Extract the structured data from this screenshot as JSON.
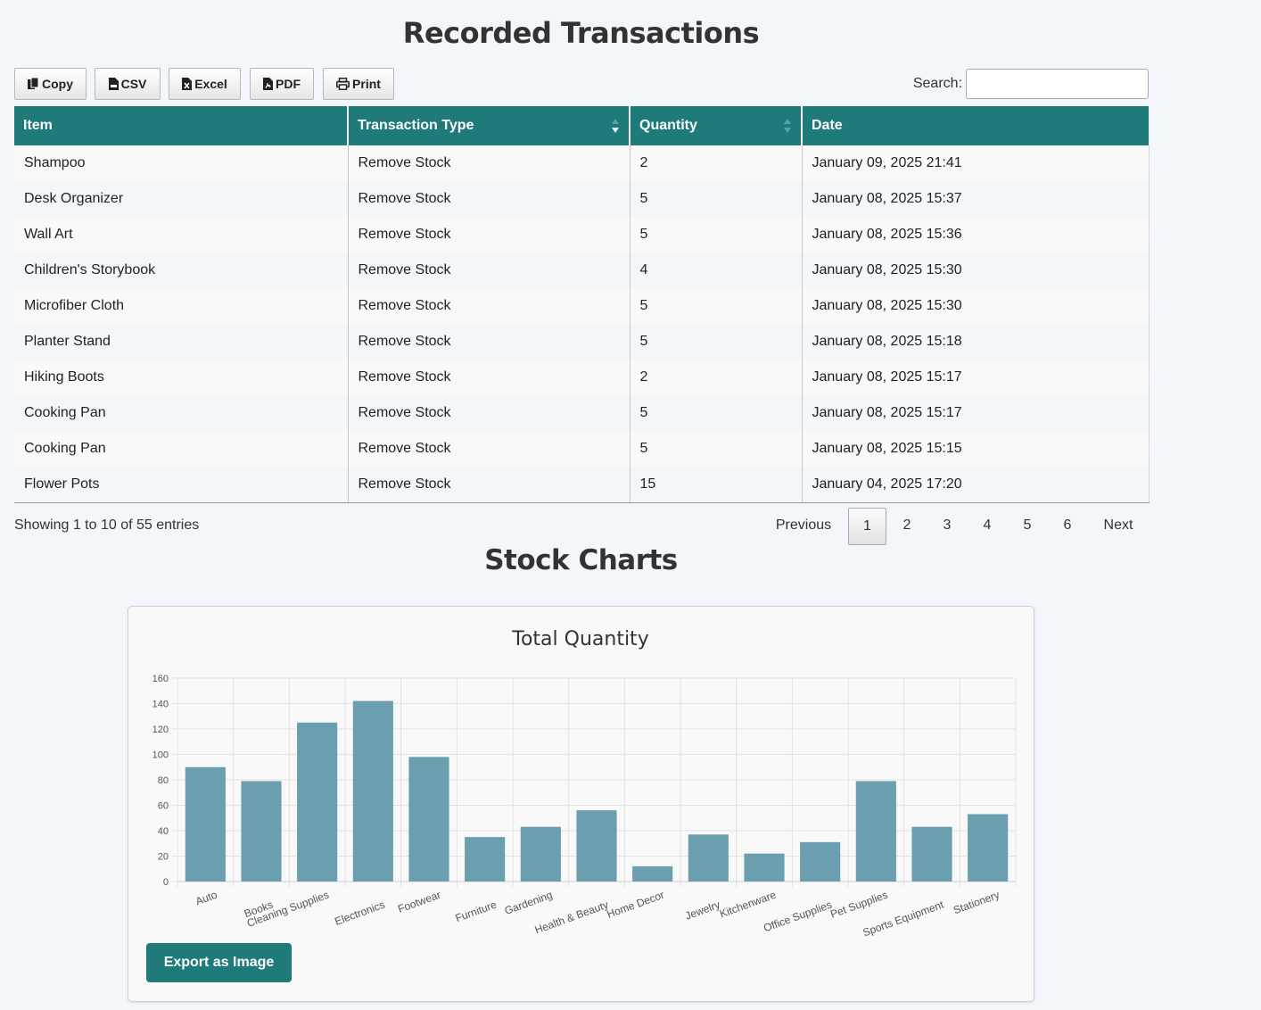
{
  "page_title": "Recorded Transactions",
  "toolbar": {
    "buttons": [
      {
        "label": "Copy",
        "icon": "copy-icon"
      },
      {
        "label": "CSV",
        "icon": "csv-file-icon"
      },
      {
        "label": "Excel",
        "icon": "excel-file-icon"
      },
      {
        "label": "PDF",
        "icon": "pdf-file-icon"
      },
      {
        "label": "Print",
        "icon": "print-icon"
      }
    ],
    "search_label": "Search:",
    "search_value": ""
  },
  "table": {
    "headers": [
      "Item",
      "Transaction Type",
      "Quantity",
      "Date"
    ],
    "header_color": "#1f7a7a",
    "rows": [
      [
        "Shampoo",
        "Remove Stock",
        "2",
        "January 09, 2025 21:41"
      ],
      [
        "Desk Organizer",
        "Remove Stock",
        "5",
        "January 08, 2025 15:37"
      ],
      [
        "Wall Art",
        "Remove Stock",
        "5",
        "January 08, 2025 15:36"
      ],
      [
        "Children's Storybook",
        "Remove Stock",
        "4",
        "January 08, 2025 15:30"
      ],
      [
        "Microfiber Cloth",
        "Remove Stock",
        "5",
        "January 08, 2025 15:30"
      ],
      [
        "Planter Stand",
        "Remove Stock",
        "5",
        "January 08, 2025 15:18"
      ],
      [
        "Hiking Boots",
        "Remove Stock",
        "2",
        "January 08, 2025 15:17"
      ],
      [
        "Cooking Pan",
        "Remove Stock",
        "5",
        "January 08, 2025 15:17"
      ],
      [
        "Cooking Pan",
        "Remove Stock",
        "5",
        "January 08, 2025 15:15"
      ],
      [
        "Flower Pots",
        "Remove Stock",
        "15",
        "January 04, 2025 17:20"
      ]
    ]
  },
  "pagination": {
    "info": "Showing 1 to 10 of 55 entries",
    "previous": "Previous",
    "pages": [
      "1",
      "2",
      "3",
      "4",
      "5",
      "6"
    ],
    "current": "1",
    "next": "Next"
  },
  "section_title": "Stock Charts",
  "export_button": "Export as Image",
  "chart_data": {
    "type": "bar",
    "title": "Total Quantity",
    "categories": [
      "Auto",
      "Books",
      "Cleaning Supplies",
      "Electronics",
      "Footwear",
      "Furniture",
      "Gardening",
      "Health & Beauty",
      "Home Decor",
      "Jewelry",
      "Kitchenware",
      "Office Supplies",
      "Pet Supplies",
      "Sports Equipment",
      "Stationery"
    ],
    "values": [
      90,
      79,
      125,
      142,
      98,
      35,
      43,
      56,
      12,
      37,
      22,
      31,
      79,
      43,
      53
    ],
    "ylim": [
      0,
      160
    ],
    "yticks": [
      0,
      20,
      40,
      60,
      80,
      100,
      120,
      140,
      160
    ],
    "xlabel": "",
    "ylabel": "",
    "bar_color": "#6b9eae",
    "grid": true
  }
}
